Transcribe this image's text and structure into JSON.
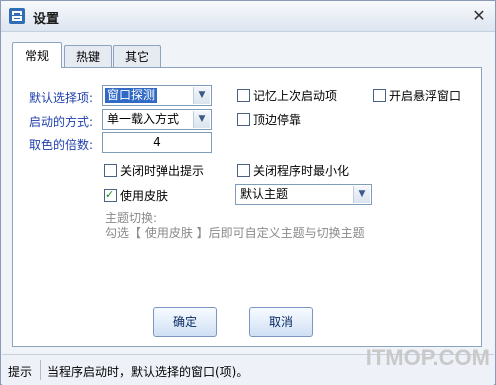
{
  "window": {
    "title": "设置"
  },
  "tabs": [
    {
      "label": "常规",
      "active": true
    },
    {
      "label": "热键",
      "active": false
    },
    {
      "label": "其它",
      "active": false
    }
  ],
  "general": {
    "default_option_label": "默认选择项:",
    "default_option_value": "窗口探测",
    "start_mode_label": "启动的方式:",
    "start_mode_value": "单一载入方式",
    "multiplier_label": "取色的倍数:",
    "multiplier_value": "4",
    "remember_last": {
      "label": "记忆上次启动项",
      "checked": false
    },
    "floating_window": {
      "label": "开启悬浮窗口",
      "checked": false
    },
    "dock_top": {
      "label": "顶边停靠",
      "checked": false
    },
    "popup_on_close": {
      "label": "关闭时弹出提示",
      "checked": false
    },
    "minimize_on_close": {
      "label": "关闭程序时最小化",
      "checked": false
    },
    "use_skin": {
      "label": "使用皮肤",
      "checked": true
    },
    "theme_value": "默认主题",
    "theme_hint_title": "主题切换:",
    "theme_hint_text": "勾选【 使用皮肤 】后即可自定义主题与切换主题"
  },
  "buttons": {
    "ok": "确定",
    "cancel": "取消"
  },
  "status": {
    "caption": "提示",
    "message": "当程序启动时，默认选择的窗口(项)。"
  },
  "watermark": "ITMOP.COM",
  "colors": {
    "accent_label": "#1f3fae",
    "selection": "#316ac5"
  }
}
